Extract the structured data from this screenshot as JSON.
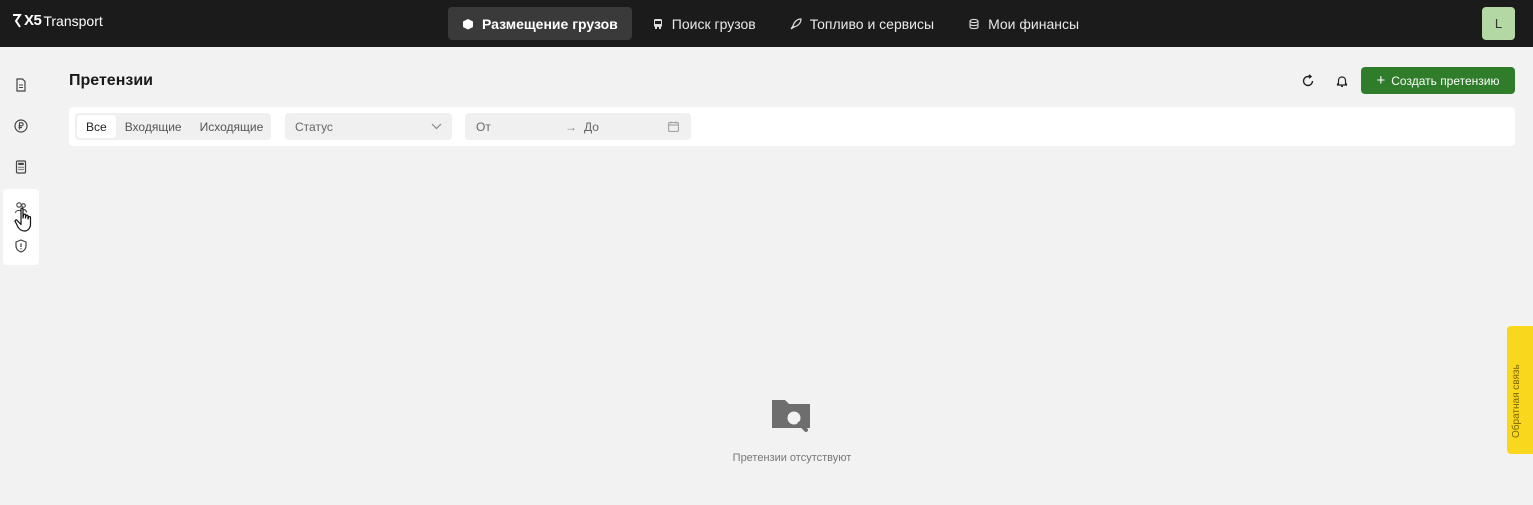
{
  "brand": {
    "mark": "X5",
    "name": "Transport"
  },
  "nav": [
    {
      "label": "Размещение грузов",
      "icon": "box-icon",
      "active": true
    },
    {
      "label": "Поиск грузов",
      "icon": "truck-icon",
      "active": false
    },
    {
      "label": "Топливо и сервисы",
      "icon": "rocket-icon",
      "active": false
    },
    {
      "label": "Мои финансы",
      "icon": "coins-icon",
      "active": false
    }
  ],
  "user": {
    "initial": "L"
  },
  "sidebar": [
    "document-icon",
    "ruble-icon",
    "calculator-icon",
    "claims-icon",
    "shield-icon"
  ],
  "page": {
    "title": "Претензии",
    "create_label": "Создать претензию"
  },
  "filters": {
    "segments": [
      "Все",
      "Входящие",
      "Исходящие"
    ],
    "status_placeholder": "Статус",
    "date_from": "От",
    "date_to": "До"
  },
  "empty": {
    "text": "Претензии отсутствуют"
  },
  "feedback": {
    "label": "Обратная связь"
  },
  "colors": {
    "accent": "#2f7d2a",
    "topbar": "#1b1b1b",
    "feedback": "#f9d71c"
  }
}
